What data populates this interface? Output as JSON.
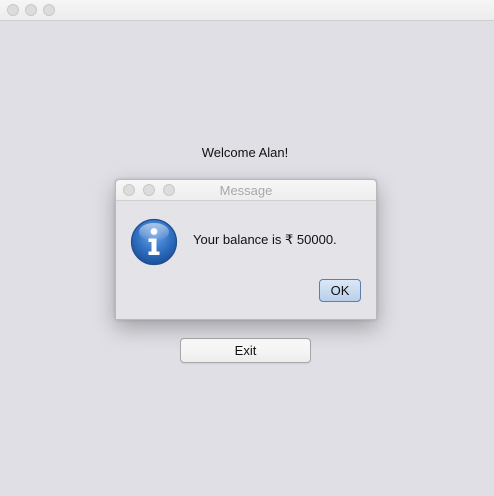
{
  "main_window": {
    "welcome_text": "Welcome Alan!",
    "exit_label": "Exit"
  },
  "dialog": {
    "title": "Message",
    "message": "Your balance is ₹ 50000.",
    "ok_label": "OK",
    "icon": "info-icon"
  },
  "colors": {
    "window_bg": "#dfdfe5",
    "info_icon_blue": "#2f6fc1",
    "ok_button": "#c6d8ee"
  }
}
